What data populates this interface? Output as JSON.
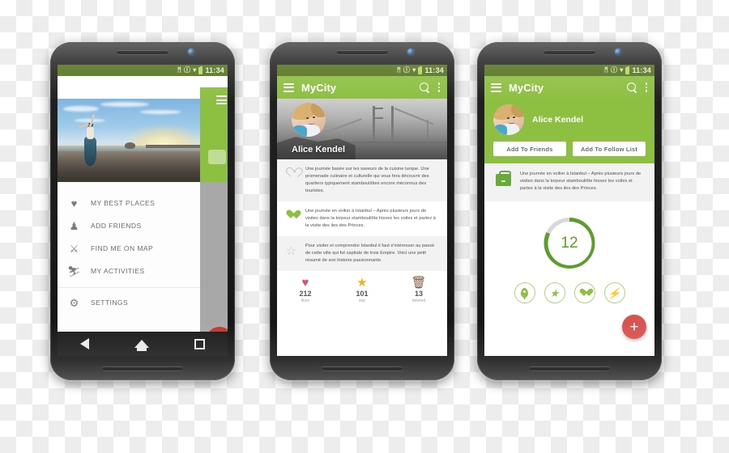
{
  "status_bar": {
    "time": "11:34",
    "icons": [
      "bluetooth-icon",
      "vibrate-icon",
      "wifi-icon",
      "signal-icon",
      "battery-icon"
    ],
    "bluetooth_glyph": "ᛗ",
    "vibrate_glyph": "Ⓘ",
    "wifi_glyph": "▾"
  },
  "colors": {
    "app_bar_green": "#8dbf41",
    "status_bar_green": "#55731f",
    "accent_red": "#d9534f",
    "dark_green": "#5c9e2e",
    "card_gray": "#f2f2f2"
  },
  "phone1": {
    "name": "navigation-drawer-screen",
    "hero_alt": "woman-on-beach-at-sunset",
    "drawer_menu": [
      {
        "label": "MY BEST PLACES",
        "icon": "heart-icon",
        "glyph": "♥"
      },
      {
        "label": "ADD FRIENDS",
        "icon": "add-friends-icon",
        "glyph": "♟"
      },
      {
        "label": "FIND ME ON MAP",
        "icon": "find-me-on-map-icon",
        "glyph": "⚔"
      },
      {
        "label": "MY ACTIVITIES",
        "icon": "activities-icon",
        "glyph": "⛷"
      }
    ],
    "settings": {
      "label": "SETTINGS",
      "icon": "gear-icon",
      "glyph": "⚙"
    },
    "nav_bar": [
      "back-button",
      "home-button",
      "recents-button"
    ]
  },
  "phone2": {
    "name": "profile-feed-screen",
    "app_bar": {
      "title": "MyCity",
      "menu_icon": "hamburger-icon",
      "search_icon": "search-icon",
      "overflow_icon": "overflow-menu-icon"
    },
    "hero_alt": "golden-gate-bridge-grayscale",
    "profile_name": "Alice Kendel",
    "feed": [
      {
        "icon": "heart-outline-icon",
        "text": "Une journée basée sur les saveurs de la cuisine turque. Une promenade culinaire et culturelle qui vous fera découvrir des quartiers typiquement stambouliôtes encore méconnus des touristes."
      },
      {
        "icon": "heart-filled-icon",
        "text": "Une journée en voilier à Istanbul – Après plusieurs jours de visites dans la torpeur stambouliôte hissez les voiles et partez à la visite des iles des Princes."
      },
      {
        "icon": "star-outline-icon",
        "text": "Pour visiter et comprendre Istanbul il faut s'intéresser au passé de cette ville qui fut capitale de trois Empire. Voici une petit résumé de son histoire passionnante."
      }
    ],
    "stats": [
      {
        "icon": "heart-icon",
        "glyph": "♥",
        "color": "#d94f6e",
        "value": "212",
        "label": "likes"
      },
      {
        "icon": "star-icon",
        "glyph": "★",
        "color": "#f2b01e",
        "value": "101",
        "label": "star"
      },
      {
        "icon": "trash-icon",
        "glyph": "🗑",
        "color": "#7a5a3a",
        "value": "13",
        "label": "deleted"
      }
    ]
  },
  "phone3": {
    "name": "public-profile-screen",
    "app_bar": {
      "title": "MyCity",
      "menu_icon": "hamburger-icon",
      "search_icon": "search-icon",
      "overflow_icon": "overflow-menu-icon"
    },
    "profile_name": "Alice Kendel",
    "buttons": [
      {
        "label": "Add To Friends",
        "name": "add-to-friends-button"
      },
      {
        "label": "Add To Follow List",
        "name": "add-to-follow-list-button"
      }
    ],
    "card": {
      "icon": "suitcase-icon",
      "text": "Une journée en voilier à Istanbul – Après plusieurs jours de visites dans la torpeur stambouliôte hissez les voiles et partez à la visite des iles des Princes."
    },
    "progress_ring": {
      "value": "12",
      "percent": 82
    },
    "chips": [
      {
        "name": "location-pin-chip",
        "icon": "location-pin-icon"
      },
      {
        "name": "star-chip",
        "icon": "star-icon",
        "glyph": "★"
      },
      {
        "name": "heart-chip",
        "icon": "heart-icon"
      },
      {
        "name": "bolt-chip",
        "icon": "lightning-bolt-icon",
        "glyph": "⚡"
      }
    ],
    "fab": {
      "name": "add-fab",
      "glyph": "+"
    }
  }
}
